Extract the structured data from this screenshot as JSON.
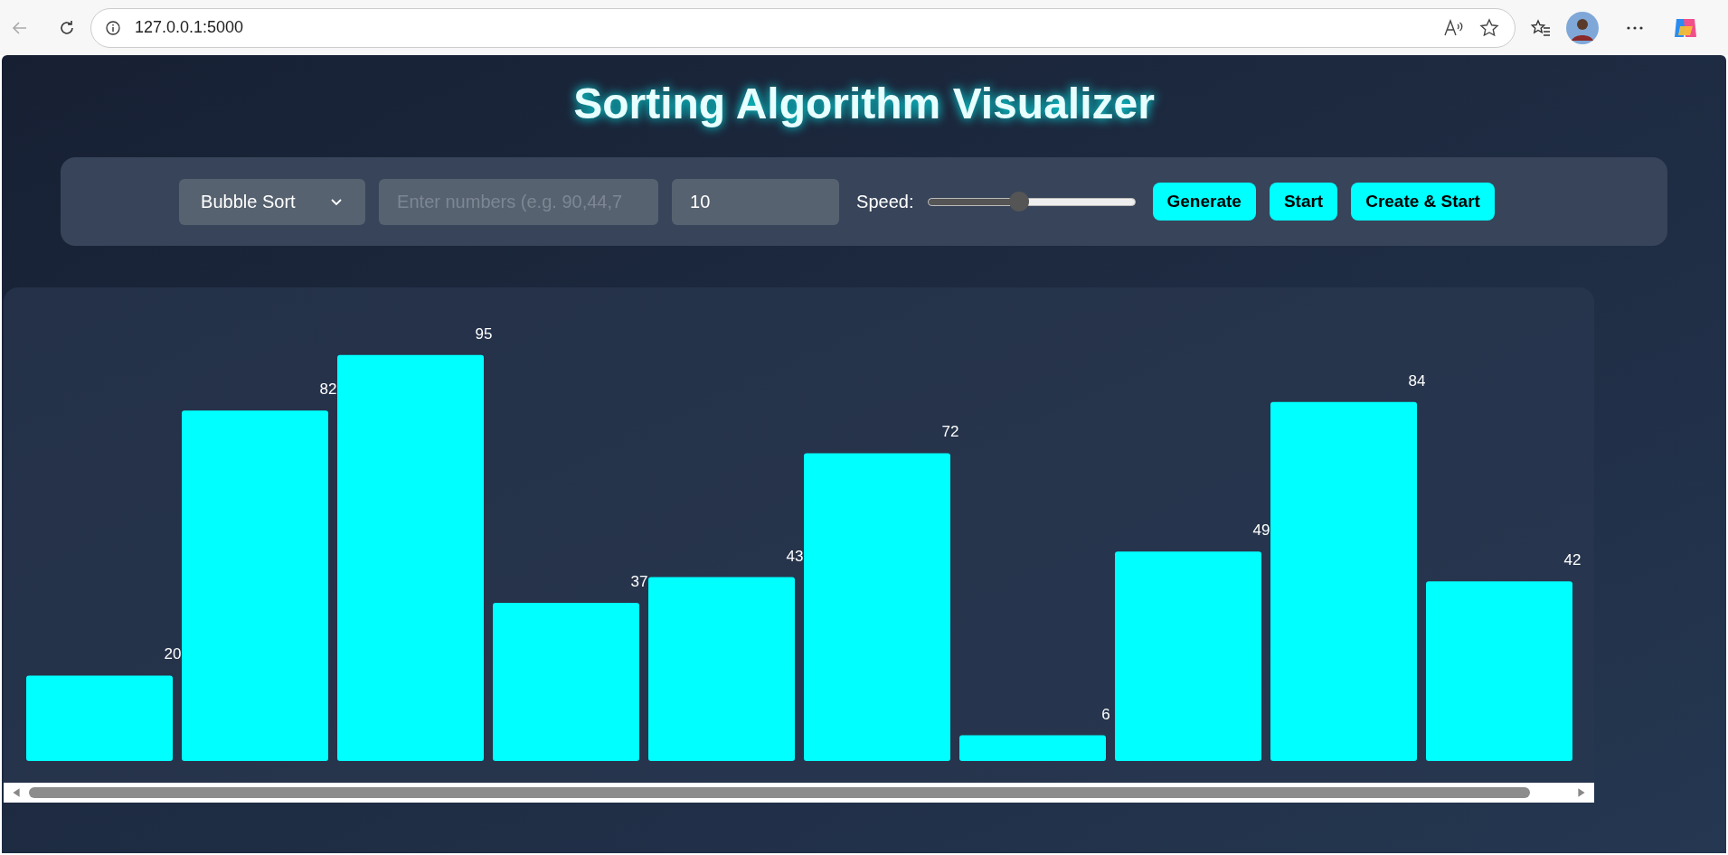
{
  "browser": {
    "url": "127.0.0.1:5000"
  },
  "title": "Sorting Algorithm Visualizer",
  "controls": {
    "algorithm": "Bubble Sort",
    "numbers_placeholder": "Enter numbers (e.g. 90,44,7",
    "size": "10",
    "speed_label": "Speed:",
    "speed": {
      "level": 0.44
    },
    "buttons": [
      "Generate",
      "Start",
      "Create & Start"
    ]
  },
  "visualizer": {
    "bars": [
      {
        "label": "20"
      },
      {
        "label": "82"
      },
      {
        "label": "95"
      },
      {
        "label": "37"
      },
      {
        "label": "43"
      },
      {
        "label": "72"
      },
      {
        "label": "6"
      },
      {
        "label": "49"
      },
      {
        "label": "84"
      },
      {
        "label": "42"
      }
    ]
  }
}
